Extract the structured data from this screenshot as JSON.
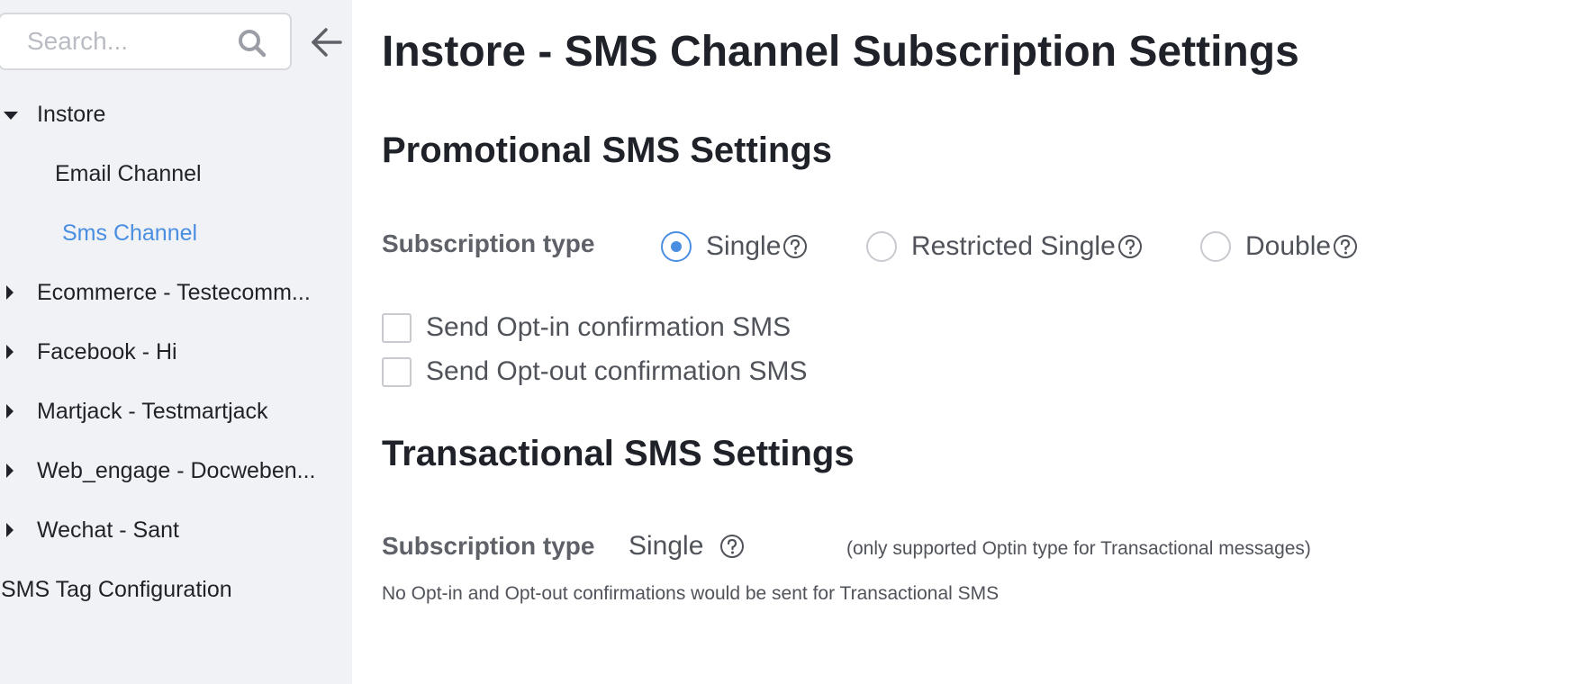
{
  "sidebar": {
    "search_placeholder": "Search...",
    "items": [
      {
        "label": "Instore",
        "caret": "down"
      },
      {
        "label": "Email Channel"
      },
      {
        "label": "Sms Channel",
        "active": true
      },
      {
        "label": "Ecommerce - Testecomm...",
        "caret": "right"
      },
      {
        "label": "Facebook - Hi",
        "caret": "right"
      },
      {
        "label": "Martjack - Testmartjack",
        "caret": "right"
      },
      {
        "label": "Web_engage - Docweben...",
        "caret": "right"
      },
      {
        "label": "Wechat - Sant",
        "caret": "right"
      },
      {
        "label": "SMS Tag Configuration"
      }
    ]
  },
  "main": {
    "title": "Instore - SMS Channel Subscription Settings",
    "promotional": {
      "title": "Promotional SMS Settings",
      "subscription_label": "Subscription type",
      "options": [
        {
          "label": "Single",
          "checked": true
        },
        {
          "label": "Restricted Single",
          "checked": false
        },
        {
          "label": "Double",
          "checked": false
        }
      ],
      "checkboxes": [
        {
          "label": "Send Opt-in confirmation SMS",
          "checked": false
        },
        {
          "label": "Send Opt-out confirmation SMS",
          "checked": false
        }
      ]
    },
    "transactional": {
      "title": "Transactional SMS Settings",
      "subscription_label": "Subscription type",
      "value": "Single",
      "note": "(only supported Optin type for Transactional messages)",
      "info": "No Opt-in and Opt-out confirmations would be sent for Transactional SMS"
    }
  },
  "colors": {
    "accent": "#4a8ee2",
    "sidebar_bg": "#f1f2f6",
    "text": "#1f2228",
    "muted_text": "#50535a"
  }
}
